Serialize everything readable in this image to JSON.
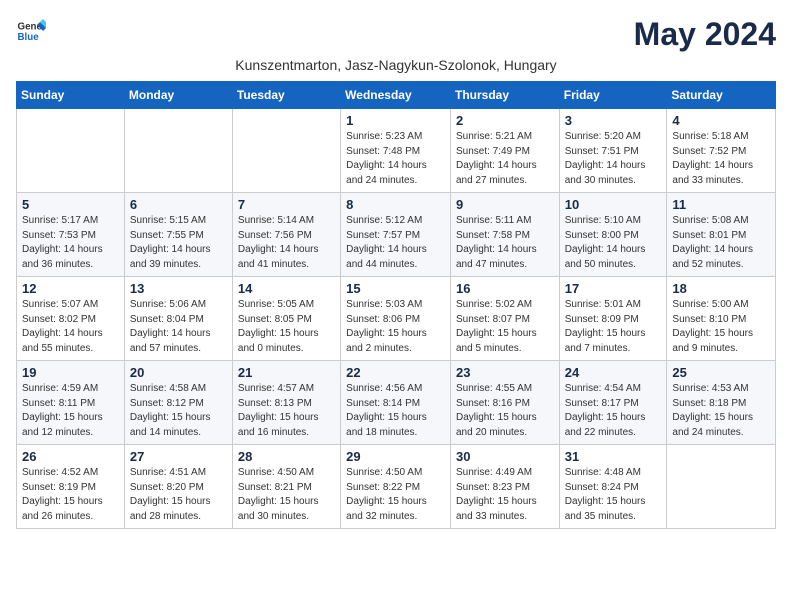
{
  "header": {
    "logo_general": "General",
    "logo_blue": "Blue",
    "month_title": "May 2024",
    "subtitle": "Kunszentmarton, Jasz-Nagykun-Szolonok, Hungary"
  },
  "columns": [
    "Sunday",
    "Monday",
    "Tuesday",
    "Wednesday",
    "Thursday",
    "Friday",
    "Saturday"
  ],
  "weeks": [
    [
      {
        "day": "",
        "info": ""
      },
      {
        "day": "",
        "info": ""
      },
      {
        "day": "",
        "info": ""
      },
      {
        "day": "1",
        "info": "Sunrise: 5:23 AM\nSunset: 7:48 PM\nDaylight: 14 hours\nand 24 minutes."
      },
      {
        "day": "2",
        "info": "Sunrise: 5:21 AM\nSunset: 7:49 PM\nDaylight: 14 hours\nand 27 minutes."
      },
      {
        "day": "3",
        "info": "Sunrise: 5:20 AM\nSunset: 7:51 PM\nDaylight: 14 hours\nand 30 minutes."
      },
      {
        "day": "4",
        "info": "Sunrise: 5:18 AM\nSunset: 7:52 PM\nDaylight: 14 hours\nand 33 minutes."
      }
    ],
    [
      {
        "day": "5",
        "info": "Sunrise: 5:17 AM\nSunset: 7:53 PM\nDaylight: 14 hours\nand 36 minutes."
      },
      {
        "day": "6",
        "info": "Sunrise: 5:15 AM\nSunset: 7:55 PM\nDaylight: 14 hours\nand 39 minutes."
      },
      {
        "day": "7",
        "info": "Sunrise: 5:14 AM\nSunset: 7:56 PM\nDaylight: 14 hours\nand 41 minutes."
      },
      {
        "day": "8",
        "info": "Sunrise: 5:12 AM\nSunset: 7:57 PM\nDaylight: 14 hours\nand 44 minutes."
      },
      {
        "day": "9",
        "info": "Sunrise: 5:11 AM\nSunset: 7:58 PM\nDaylight: 14 hours\nand 47 minutes."
      },
      {
        "day": "10",
        "info": "Sunrise: 5:10 AM\nSunset: 8:00 PM\nDaylight: 14 hours\nand 50 minutes."
      },
      {
        "day": "11",
        "info": "Sunrise: 5:08 AM\nSunset: 8:01 PM\nDaylight: 14 hours\nand 52 minutes."
      }
    ],
    [
      {
        "day": "12",
        "info": "Sunrise: 5:07 AM\nSunset: 8:02 PM\nDaylight: 14 hours\nand 55 minutes."
      },
      {
        "day": "13",
        "info": "Sunrise: 5:06 AM\nSunset: 8:04 PM\nDaylight: 14 hours\nand 57 minutes."
      },
      {
        "day": "14",
        "info": "Sunrise: 5:05 AM\nSunset: 8:05 PM\nDaylight: 15 hours\nand 0 minutes."
      },
      {
        "day": "15",
        "info": "Sunrise: 5:03 AM\nSunset: 8:06 PM\nDaylight: 15 hours\nand 2 minutes."
      },
      {
        "day": "16",
        "info": "Sunrise: 5:02 AM\nSunset: 8:07 PM\nDaylight: 15 hours\nand 5 minutes."
      },
      {
        "day": "17",
        "info": "Sunrise: 5:01 AM\nSunset: 8:09 PM\nDaylight: 15 hours\nand 7 minutes."
      },
      {
        "day": "18",
        "info": "Sunrise: 5:00 AM\nSunset: 8:10 PM\nDaylight: 15 hours\nand 9 minutes."
      }
    ],
    [
      {
        "day": "19",
        "info": "Sunrise: 4:59 AM\nSunset: 8:11 PM\nDaylight: 15 hours\nand 12 minutes."
      },
      {
        "day": "20",
        "info": "Sunrise: 4:58 AM\nSunset: 8:12 PM\nDaylight: 15 hours\nand 14 minutes."
      },
      {
        "day": "21",
        "info": "Sunrise: 4:57 AM\nSunset: 8:13 PM\nDaylight: 15 hours\nand 16 minutes."
      },
      {
        "day": "22",
        "info": "Sunrise: 4:56 AM\nSunset: 8:14 PM\nDaylight: 15 hours\nand 18 minutes."
      },
      {
        "day": "23",
        "info": "Sunrise: 4:55 AM\nSunset: 8:16 PM\nDaylight: 15 hours\nand 20 minutes."
      },
      {
        "day": "24",
        "info": "Sunrise: 4:54 AM\nSunset: 8:17 PM\nDaylight: 15 hours\nand 22 minutes."
      },
      {
        "day": "25",
        "info": "Sunrise: 4:53 AM\nSunset: 8:18 PM\nDaylight: 15 hours\nand 24 minutes."
      }
    ],
    [
      {
        "day": "26",
        "info": "Sunrise: 4:52 AM\nSunset: 8:19 PM\nDaylight: 15 hours\nand 26 minutes."
      },
      {
        "day": "27",
        "info": "Sunrise: 4:51 AM\nSunset: 8:20 PM\nDaylight: 15 hours\nand 28 minutes."
      },
      {
        "day": "28",
        "info": "Sunrise: 4:50 AM\nSunset: 8:21 PM\nDaylight: 15 hours\nand 30 minutes."
      },
      {
        "day": "29",
        "info": "Sunrise: 4:50 AM\nSunset: 8:22 PM\nDaylight: 15 hours\nand 32 minutes."
      },
      {
        "day": "30",
        "info": "Sunrise: 4:49 AM\nSunset: 8:23 PM\nDaylight: 15 hours\nand 33 minutes."
      },
      {
        "day": "31",
        "info": "Sunrise: 4:48 AM\nSunset: 8:24 PM\nDaylight: 15 hours\nand 35 minutes."
      },
      {
        "day": "",
        "info": ""
      }
    ]
  ]
}
